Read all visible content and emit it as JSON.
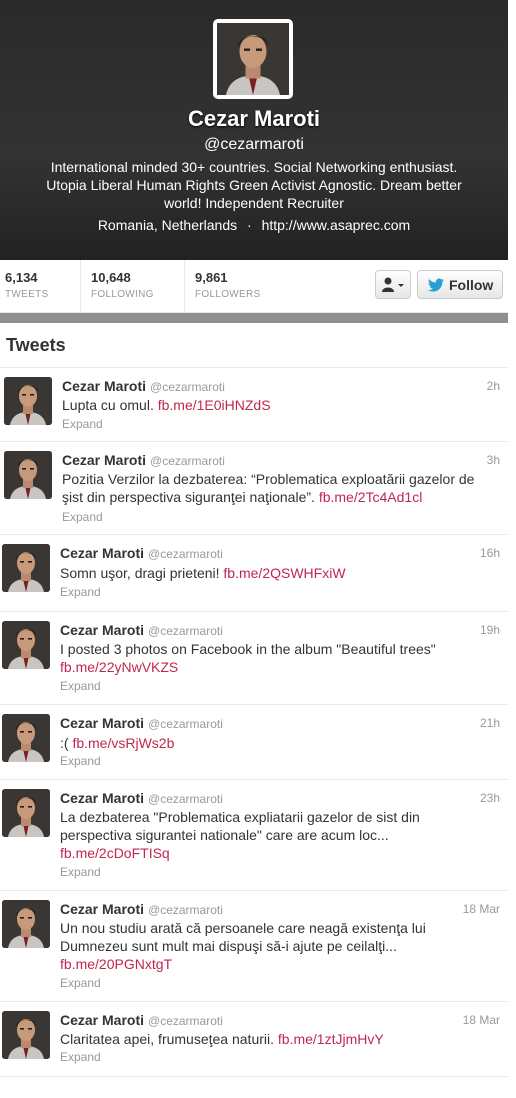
{
  "profile": {
    "name": "Cezar Maroti",
    "handle": "@cezarmaroti",
    "bio": "International minded 30+ countries. Social Networking enthusiast. Utopia Liberal Human Rights Green Activist Agnostic. Dream better world! Independent Recruiter",
    "location": "Romania, Netherlands",
    "separator": "·",
    "url": "http://www.asaprec.com"
  },
  "stats": {
    "tweets": {
      "value": "6,134",
      "label": "TWEETS"
    },
    "following": {
      "value": "10,648",
      "label": "FOLLOWING"
    },
    "followers": {
      "value": "9,861",
      "label": "FOLLOWERS"
    }
  },
  "actions": {
    "follow_label": "Follow",
    "user_menu_icon": "user-dropdown-icon",
    "bird_icon": "twitter-bird-icon"
  },
  "tweets_heading": "Tweets",
  "colors": {
    "link": "#c0274f",
    "follow_bird": "#2a9fd6",
    "header_bg": "#2e2e2e"
  },
  "tweets": [
    {
      "name": "Cezar Maroti",
      "screen_name": "@cezarmaroti",
      "time": "2h",
      "text": "Lupta cu omul. ",
      "link": "fb.me/1E0iHNZdS",
      "expand": "Expand"
    },
    {
      "name": "Cezar Maroti",
      "screen_name": "@cezarmaroti",
      "time": "3h",
      "text": "Pozitia Verzilor la dezbaterea: “Problematica exploatării gazelor de şist din perspectiva siguranţei naţionale”. ",
      "link": "fb.me/2Tc4Ad1cl",
      "expand": "Expand"
    },
    {
      "name": "Cezar Maroti",
      "screen_name": "@cezarmaroti",
      "time": "16h",
      "text": "Somn uşor, dragi prieteni! ",
      "link": "fb.me/2QSWHFxiW",
      "expand": "Expand"
    },
    {
      "name": "Cezar Maroti",
      "screen_name": "@cezarmaroti",
      "time": "19h",
      "text": "I posted 3 photos on Facebook in the album \"Beautiful trees\" ",
      "link": "fb.me/22yNwVKZS",
      "expand": "Expand"
    },
    {
      "name": "Cezar Maroti",
      "screen_name": "@cezarmaroti",
      "time": "21h",
      "text": ":( ",
      "link": "fb.me/vsRjWs2b",
      "expand": "Expand"
    },
    {
      "name": "Cezar Maroti",
      "screen_name": "@cezarmaroti",
      "time": "23h",
      "text": "La dezbaterea \"Problematica expliatarii gazelor de sist din perspectiva sigurantei nationale\" care are acum loc... ",
      "link": "fb.me/2cDoFTISq",
      "expand": "Expand"
    },
    {
      "name": "Cezar Maroti",
      "screen_name": "@cezarmaroti",
      "time": "18 Mar",
      "text": "Un nou studiu arată că persoanele care neagă existenţa lui Dumnezeu sunt mult mai dispuşi să-i ajute pe ceilalţi... ",
      "link": "fb.me/20PGNxtgT",
      "expand": "Expand"
    },
    {
      "name": "Cezar Maroti",
      "screen_name": "@cezarmaroti",
      "time": "18 Mar",
      "text": "Claritatea apei, frumuseţea naturii. ",
      "link": "fb.me/1ztJjmHvY",
      "expand": "Expand"
    }
  ]
}
